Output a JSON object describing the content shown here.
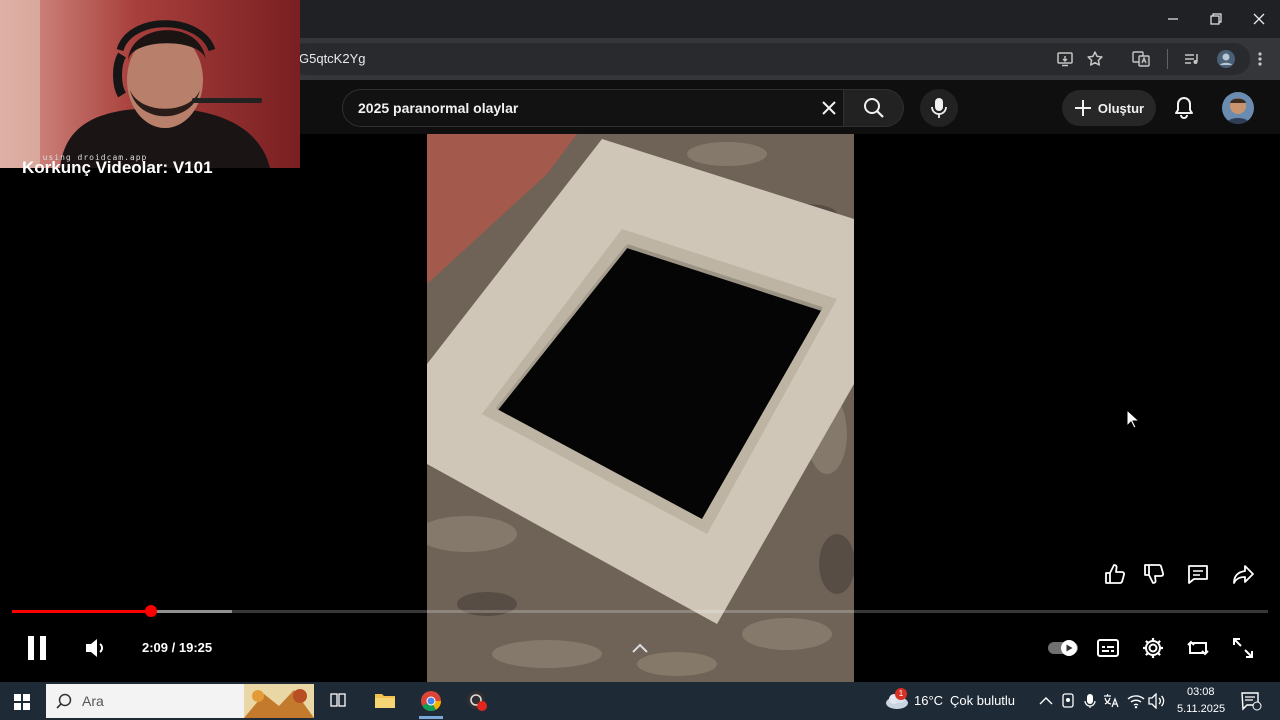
{
  "browser": {
    "url": "G5qtcK2Yg",
    "window_controls": [
      "minimize-icon",
      "restore-icon",
      "close-icon"
    ]
  },
  "youtube": {
    "search_query": "2025 paranormal olaylar",
    "create_label": "Oluştur"
  },
  "webcam": {
    "caption": "using droidcam.app",
    "title_peek": "Korkunç Videolar: V101"
  },
  "player": {
    "current_time": "2:09",
    "duration": "19:25",
    "time_display": "2:09 / 19:25",
    "progress_fraction": 0.111,
    "buffer_fraction": 0.175,
    "colors": {
      "played": "#ff0000",
      "accent": "#ff0000"
    }
  },
  "taskbar": {
    "search_placeholder": "Ara",
    "weather_temp": "16°C",
    "weather_desc": "Çok bulutlu",
    "weather_badge": "1",
    "clock_time": "03:08",
    "clock_date": "5.11.2025"
  }
}
